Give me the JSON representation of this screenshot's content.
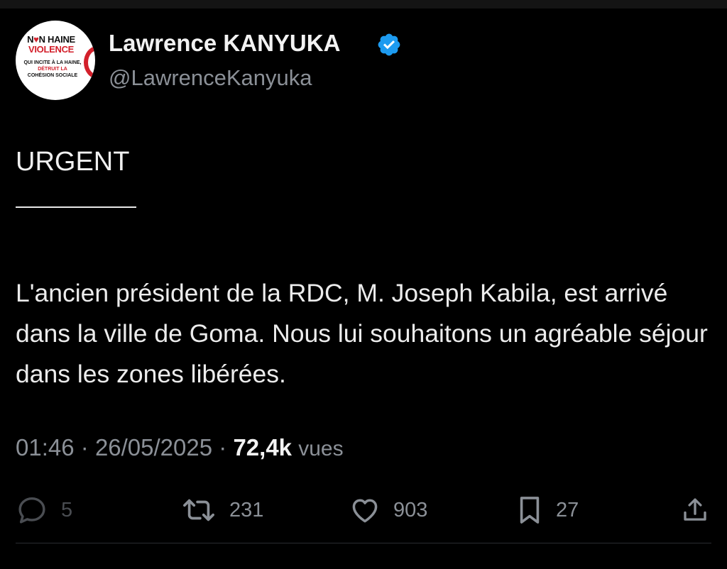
{
  "author": {
    "avatar_lines": {
      "line1_a": "N",
      "line1_b": "♥",
      "line1_c": "N HAINE",
      "line2": "VIOLENCE",
      "line3_a": "QUI INCITE À LA HAINE,",
      "line3_b": "DÉTRUIT LA",
      "line3_c": "COHÉSION SOCIALE"
    },
    "display_name": "Lawrence KANYUKA",
    "handle": "@LawrenceKanyuka",
    "verified": true
  },
  "tweet": {
    "heading": "URGENT",
    "body": "L'ancien président de la RDC, M. Joseph Kabila, est arrivé dans la ville de Goma. Nous lui souhaitons un agréable séjour dans les zones libérées.",
    "time": "01:46",
    "separator": "·",
    "date": "26/05/2025",
    "views": "72,4k",
    "views_label": "vues"
  },
  "actions": {
    "replies": "5",
    "retweets": "231",
    "likes": "903",
    "bookmarks": "27"
  },
  "colors": {
    "background": "#000000",
    "secondary_text": "#8b9097",
    "verified_badge": "#1d9bf0",
    "avatar_red": "#d3202b"
  },
  "icons": [
    "verified-badge-icon",
    "reply-icon",
    "retweet-icon",
    "like-icon",
    "bookmark-icon",
    "share-icon"
  ]
}
